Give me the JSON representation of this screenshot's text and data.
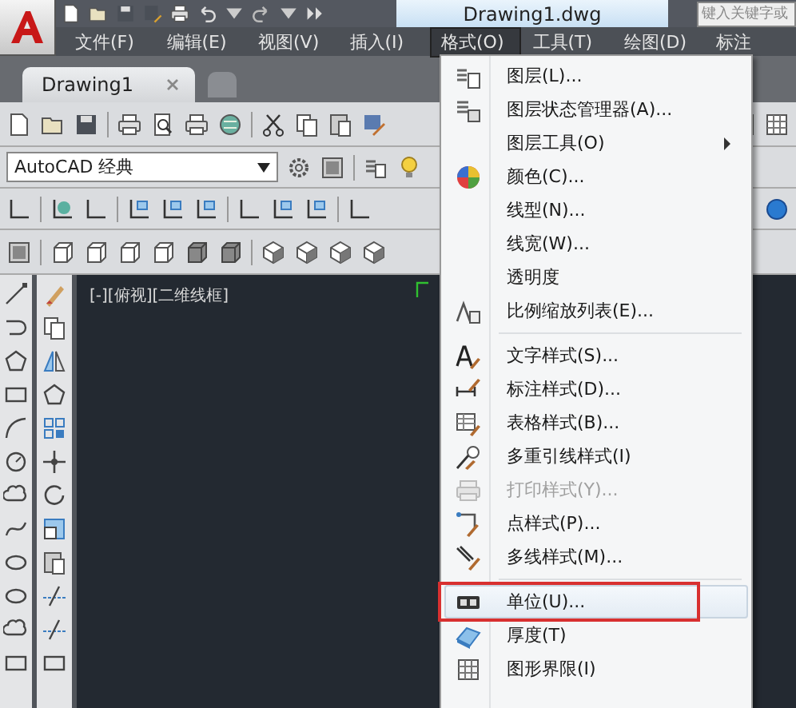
{
  "window": {
    "title": "Drawing1.dwg"
  },
  "search": {
    "placeholder": "键入关键字或"
  },
  "menu_bar": [
    {
      "label": "文件(F)",
      "selected": false
    },
    {
      "label": "编辑(E)",
      "selected": false
    },
    {
      "label": "视图(V)",
      "selected": false
    },
    {
      "label": "插入(I)",
      "selected": false
    },
    {
      "label": "格式(O)",
      "selected": true
    },
    {
      "label": "工具(T)",
      "selected": false
    },
    {
      "label": "绘图(D)",
      "selected": false
    },
    {
      "label": "标注",
      "selected": false
    }
  ],
  "tabs": [
    {
      "kind": "document",
      "label": "Drawing1",
      "selected": true
    },
    {
      "kind": "new",
      "selected": false
    }
  ],
  "workspace": {
    "value": "AutoCAD 经典"
  },
  "viewport": {
    "label": "[-][俯视][二维线框]"
  },
  "format_menu": [
    {
      "kind": "item",
      "label": "图层(L)...",
      "selected": false,
      "disabled": false,
      "submenu": false
    },
    {
      "kind": "item",
      "label": "图层状态管理器(A)...",
      "selected": false,
      "disabled": false,
      "submenu": false
    },
    {
      "kind": "item",
      "label": "图层工具(O)",
      "selected": false,
      "disabled": false,
      "submenu": true
    },
    {
      "kind": "item",
      "label": "颜色(C)...",
      "selected": false,
      "disabled": false,
      "submenu": false
    },
    {
      "kind": "item",
      "label": "线型(N)...",
      "selected": false,
      "disabled": false,
      "submenu": false
    },
    {
      "kind": "item",
      "label": "线宽(W)...",
      "selected": false,
      "disabled": false,
      "submenu": false
    },
    {
      "kind": "item",
      "label": "透明度",
      "selected": false,
      "disabled": false,
      "submenu": false
    },
    {
      "kind": "item",
      "label": "比例缩放列表(E)...",
      "selected": false,
      "disabled": false,
      "submenu": false
    },
    {
      "kind": "separator"
    },
    {
      "kind": "item",
      "label": "文字样式(S)...",
      "selected": false,
      "disabled": false,
      "submenu": false
    },
    {
      "kind": "item",
      "label": "标注样式(D)...",
      "selected": false,
      "disabled": false,
      "submenu": false
    },
    {
      "kind": "item",
      "label": "表格样式(B)...",
      "selected": false,
      "disabled": false,
      "submenu": false
    },
    {
      "kind": "item",
      "label": "多重引线样式(I)",
      "selected": false,
      "disabled": false,
      "submenu": false
    },
    {
      "kind": "item",
      "label": "打印样式(Y)...",
      "selected": false,
      "disabled": true,
      "submenu": false
    },
    {
      "kind": "item",
      "label": "点样式(P)...",
      "selected": false,
      "disabled": false,
      "submenu": false
    },
    {
      "kind": "item",
      "label": "多线样式(M)...",
      "selected": false,
      "disabled": false,
      "submenu": false
    },
    {
      "kind": "separator"
    },
    {
      "kind": "item",
      "label": "单位(U)...",
      "selected": true,
      "disabled": false,
      "submenu": false
    },
    {
      "kind": "item",
      "label": "厚度(T)",
      "selected": false,
      "disabled": false,
      "submenu": false
    },
    {
      "kind": "item",
      "label": "图形界限(I)",
      "selected": false,
      "disabled": false,
      "submenu": false
    }
  ]
}
